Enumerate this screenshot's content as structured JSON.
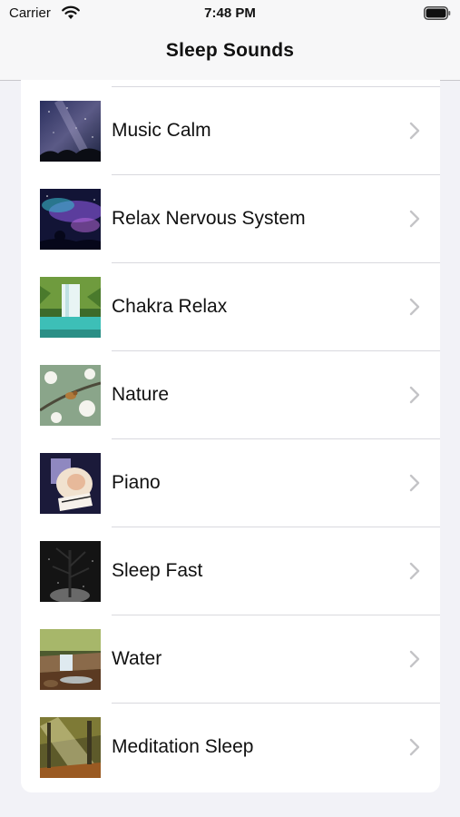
{
  "status_bar": {
    "carrier": "Carrier",
    "time": "7:48 PM"
  },
  "nav": {
    "title": "Sleep Sounds"
  },
  "list": {
    "items": [
      {
        "label": "Music Calm",
        "icon": "starry-sky-thumbnail"
      },
      {
        "label": "Relax Nervous System",
        "icon": "aurora-night-thumbnail"
      },
      {
        "label": "Chakra Relax",
        "icon": "waterfall-thumbnail"
      },
      {
        "label": "Nature",
        "icon": "bird-blossom-thumbnail"
      },
      {
        "label": "Piano",
        "icon": "piano-thumbnail"
      },
      {
        "label": "Sleep Fast",
        "icon": "night-forest-thumbnail"
      },
      {
        "label": "Water",
        "icon": "stream-thumbnail"
      },
      {
        "label": "Meditation Sleep",
        "icon": "sunlit-forest-thumbnail"
      }
    ]
  },
  "colors": {
    "background": "#f2f2f7",
    "card": "#ffffff",
    "separator": "#d9d9de",
    "chevron": "#c4c4c7"
  }
}
